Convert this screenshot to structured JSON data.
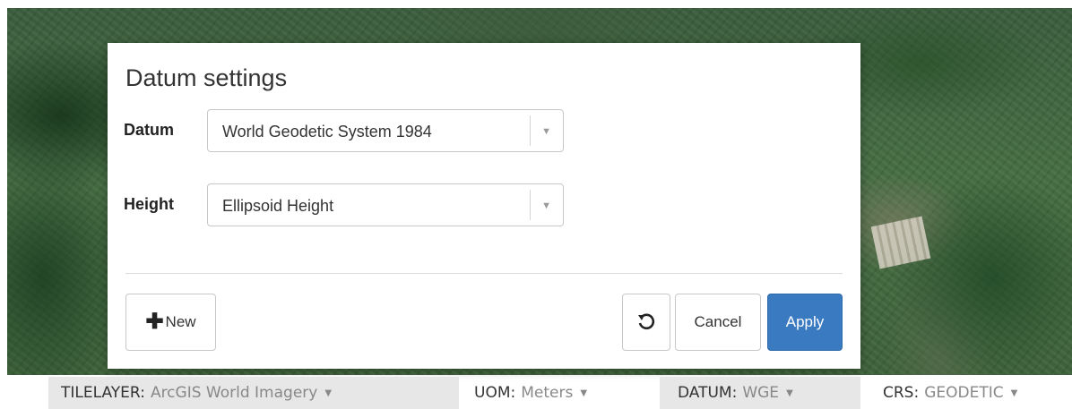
{
  "dialog": {
    "title": "Datum settings",
    "datum": {
      "label": "Datum",
      "value": "World Geodetic System 1984"
    },
    "height": {
      "label": "Height",
      "value": "Ellipsoid Height"
    },
    "buttons": {
      "new": "New",
      "cancel": "Cancel",
      "apply": "Apply"
    },
    "icons": {
      "new": "plus-icon",
      "reset": "reset-icon",
      "dropdown": "caret-down-icon"
    }
  },
  "statusbar": {
    "tilelayer": {
      "key": "TILELAYER:",
      "value": "ArcGIS World Imagery"
    },
    "uom": {
      "key": "UOM:",
      "value": "Meters"
    },
    "datum": {
      "key": "DATUM:",
      "value": "WGE"
    },
    "crs": {
      "key": "CRS:",
      "value": "GEODETIC"
    }
  },
  "colors": {
    "apply_button": "#3a7ac0",
    "shaded_chip": "#e7e7e7"
  }
}
